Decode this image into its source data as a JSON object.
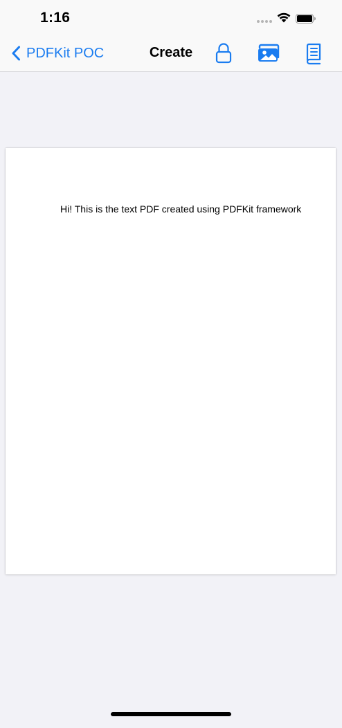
{
  "status_bar": {
    "time": "1:16"
  },
  "nav_bar": {
    "back_label": "PDFKit POC",
    "title": "Create",
    "icons": [
      "chevron-left-icon",
      "lock-icon",
      "photo-library-icon",
      "book-icon"
    ]
  },
  "document": {
    "text": "Hi! This is the text PDF created using PDFKit framework"
  },
  "colors": {
    "accent": "#1a7cf0",
    "background": "#f2f2f7",
    "bar": "#f9f9f9"
  }
}
